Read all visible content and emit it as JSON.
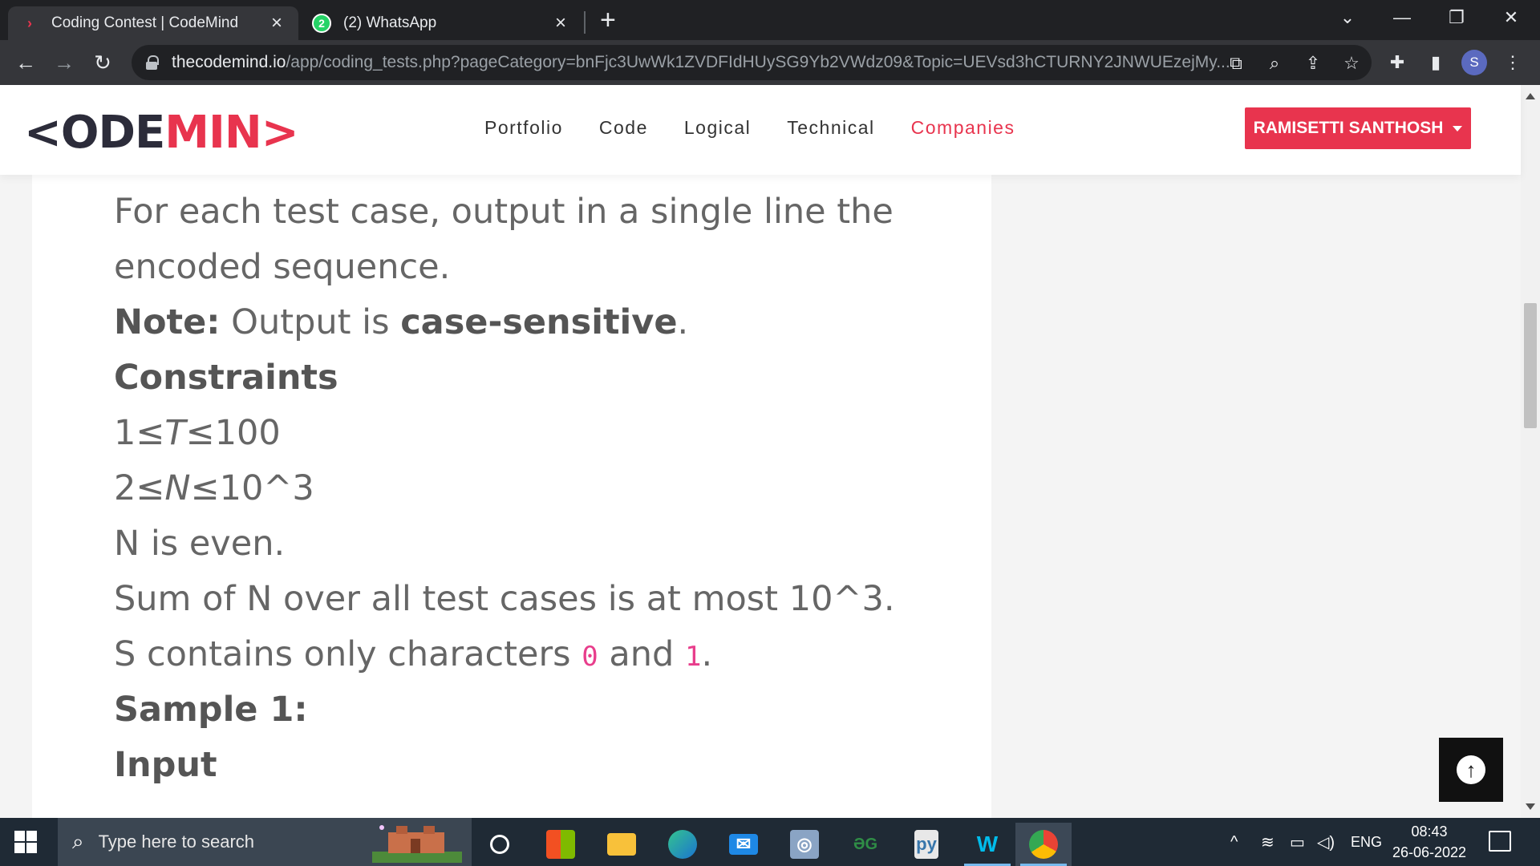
{
  "browser": {
    "tabs": [
      {
        "title": "Coding Contest | CodeMind",
        "active": true,
        "favicon": "codemind-favicon"
      },
      {
        "title": "(2) WhatsApp",
        "active": false,
        "favicon": "whatsapp-icon",
        "badge": "2"
      }
    ],
    "url_host": "thecodemind.io",
    "url_path": "/app/coding_tests.php?pageCategory=bnFjc3UwWk1ZVDFIdHUySG9Yb2VWdz09&Topic=UEVsd3hCTURNY2JNWUEzejMy...",
    "profile_initial": "S"
  },
  "site": {
    "logo_part1": "<ODE",
    "logo_part2": "MIN>",
    "nav": [
      "Portfolio",
      "Code",
      "Logical",
      "Technical",
      "Companies"
    ],
    "active_nav": "Companies",
    "user_button": "RAMISETTI SANTHOSH",
    "accent_color": "#e8344e"
  },
  "content": {
    "output_line1": "For each test case, output in a single line the",
    "output_line2": "encoded sequence.",
    "note_label": "Note:",
    "note_text": " Output is ",
    "note_bold": "case-sensitive",
    "note_end": ".",
    "constraints_heading": "Constraints",
    "c1_a": "1≤",
    "c1_var": "T",
    "c1_b": "≤100",
    "c2_a": "2≤",
    "c2_var": "N",
    "c2_b": "≤10^3",
    "c3": "N is even.",
    "c4": "Sum of N over all test cases is at most 10^3.",
    "c5_a": "S contains only characters ",
    "c5_code1": "0",
    "c5_mid": " and ",
    "c5_code2": "1",
    "c5_end": ".",
    "sample_heading": "Sample 1:",
    "input_heading": "Input"
  },
  "taskbar": {
    "search_placeholder": "Type here to search",
    "apps": [
      "task-view",
      "microsoft-store",
      "file-explorer",
      "edge",
      "mail",
      "vpn",
      "geeksforgeeks",
      "python-file",
      "webex",
      "chrome"
    ],
    "language": "ENG",
    "time": "08:43",
    "date": "26-06-2022"
  }
}
